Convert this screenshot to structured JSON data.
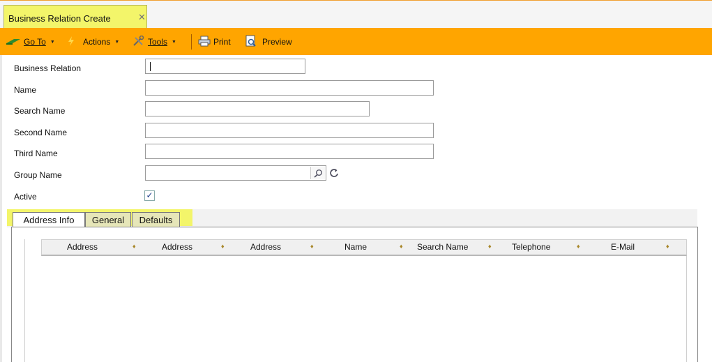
{
  "tab": {
    "title": "Business Relation Create",
    "close_glyph": "✕"
  },
  "toolbar": {
    "goto": "Go To",
    "actions": "Actions",
    "tools": "Tools",
    "print": "Print",
    "preview": "Preview"
  },
  "form": {
    "business_relation_label": "Business Relation",
    "name_label": "Name",
    "search_name_label": "Search Name",
    "second_name_label": "Second Name",
    "third_name_label": "Third Name",
    "group_name_label": "Group Name",
    "active_label": "Active",
    "active_checked": true
  },
  "tabs": [
    "Address Info",
    "General",
    "Defaults"
  ],
  "grid": {
    "columns": [
      "Address",
      "Address",
      "Address",
      "Name",
      "Search Name",
      "Telephone",
      "E-Mail"
    ]
  },
  "colors": {
    "toolbar": "#ffa500",
    "highlight": "#f3f56a"
  }
}
